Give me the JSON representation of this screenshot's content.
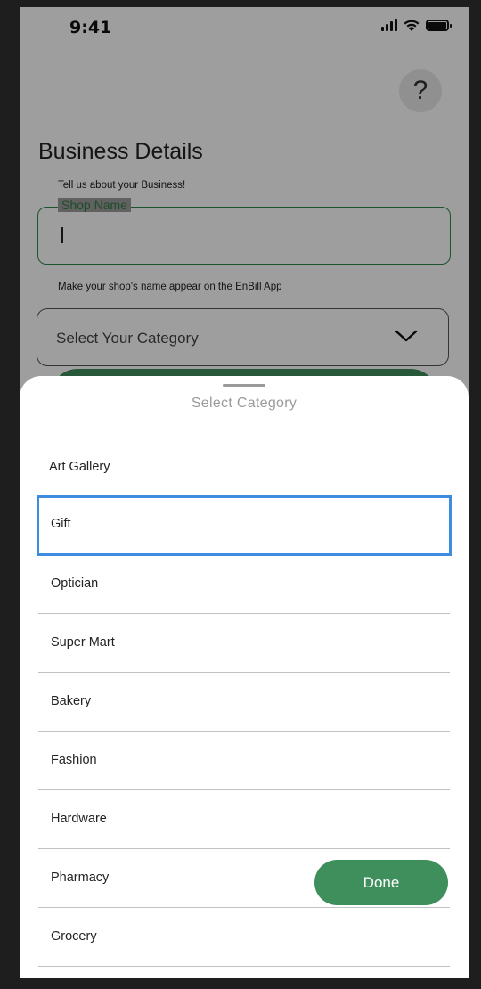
{
  "status_bar": {
    "time": "9:41"
  },
  "header": {
    "help_label": "?"
  },
  "page": {
    "title": "Business Details",
    "subtitle": "Tell us about your Business!"
  },
  "shop_name": {
    "label": "Shop Name",
    "value": "",
    "hint": "Make your shop's name appear on the EnBill App"
  },
  "category": {
    "placeholder": "Select Your Category"
  },
  "sheet": {
    "title": "Select Category",
    "items": [
      {
        "label": "Art Gallery"
      },
      {
        "label": "Gift",
        "selected": true
      },
      {
        "label": "Optician"
      },
      {
        "label": "Super Mart"
      },
      {
        "label": "Bakery"
      },
      {
        "label": "Fashion"
      },
      {
        "label": "Hardware"
      },
      {
        "label": "Pharmacy"
      },
      {
        "label": "Grocery"
      }
    ],
    "done_label": "Done"
  },
  "colors": {
    "accent_green": "#3e8f5c",
    "selection_blue": "#3e8ce0",
    "background": "#ffffff"
  }
}
